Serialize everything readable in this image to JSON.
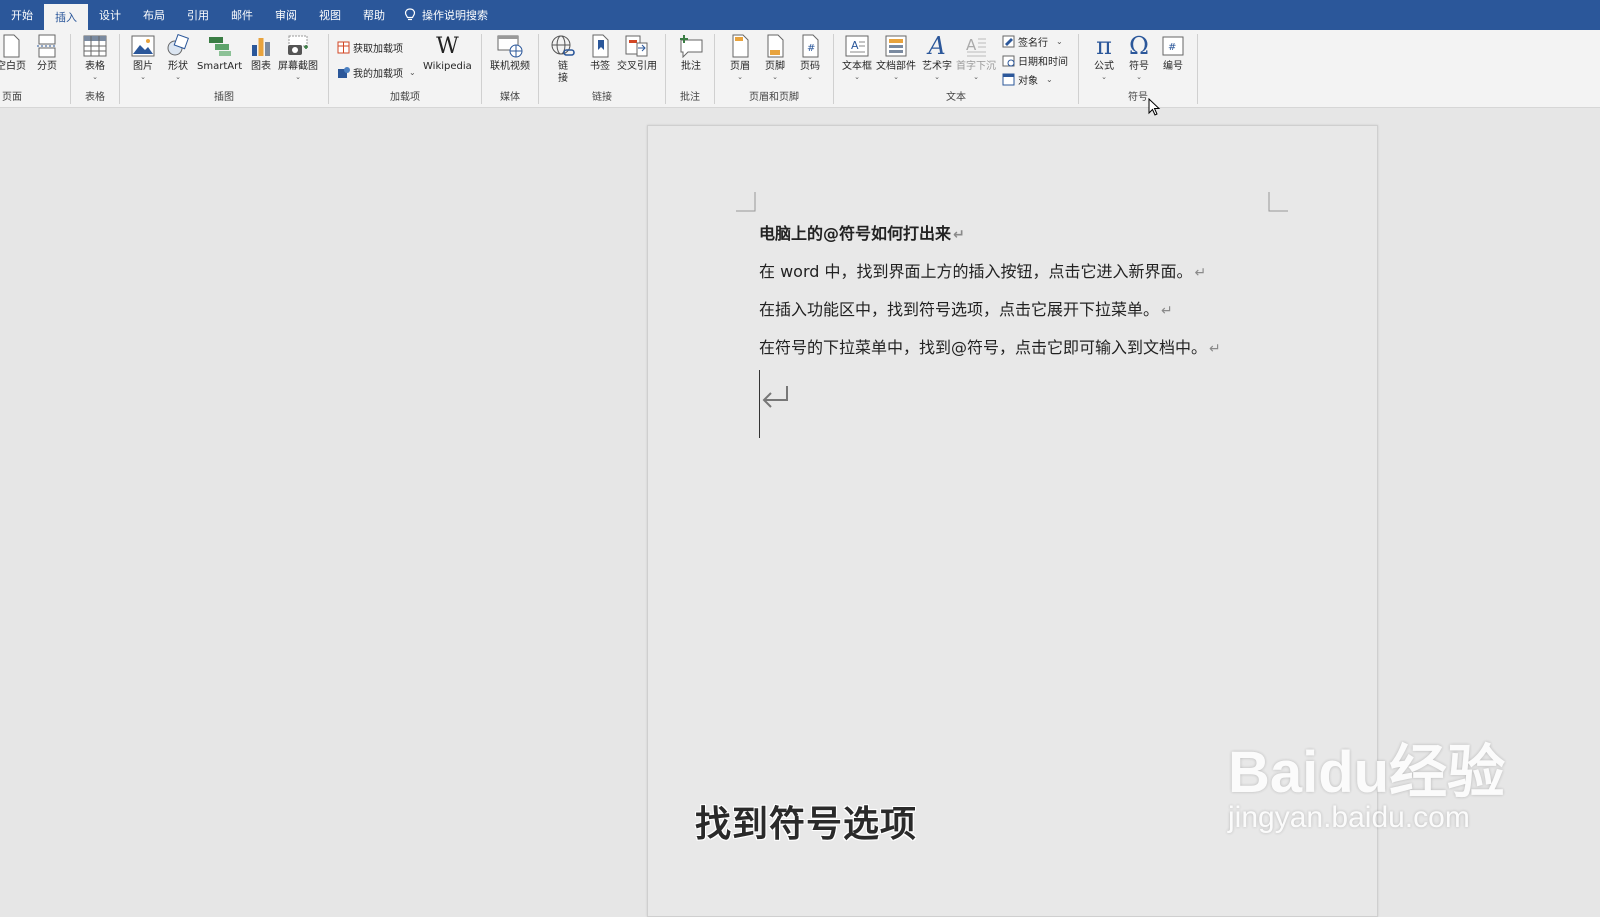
{
  "tabs": [
    {
      "label": "开始"
    },
    {
      "label": "插入",
      "active": true
    },
    {
      "label": "设计"
    },
    {
      "label": "布局"
    },
    {
      "label": "引用"
    },
    {
      "label": "邮件"
    },
    {
      "label": "审阅"
    },
    {
      "label": "视图"
    },
    {
      "label": "帮助"
    }
  ],
  "tellme": {
    "label": "操作说明搜索"
  },
  "ribbon": {
    "pages": {
      "label": "页面",
      "blank_page": "空白页",
      "page_break": "分页"
    },
    "tables": {
      "label": "表格",
      "table": "表格"
    },
    "illustrations": {
      "label": "插图",
      "picture": "图片",
      "shapes": "形状",
      "smartart": "SmartArt",
      "chart": "图表",
      "screenshot": "屏幕截图"
    },
    "addins": {
      "label": "加载项",
      "get_addins": "获取加载项",
      "my_addins": "我的加载项",
      "wikipedia": "Wikipedia"
    },
    "media": {
      "label": "媒体",
      "online_video": "联机视频"
    },
    "links": {
      "label": "链接",
      "link_line1": "链",
      "link_line2": "接",
      "bookmark": "书签",
      "cross_ref": "交叉引用"
    },
    "comments": {
      "label": "批注",
      "comment": "批注"
    },
    "header_footer": {
      "label": "页眉和页脚",
      "header": "页眉",
      "footer": "页脚",
      "page_number": "页码"
    },
    "text": {
      "label": "文本",
      "textbox": "文本框",
      "quick_parts": "文档部件",
      "wordart": "艺术字",
      "dropcap": "首字下沉",
      "signature": "签名行",
      "datetime": "日期和时间",
      "object": "对象"
    },
    "symbols": {
      "label": "符号",
      "equation": "公式",
      "symbol": "符号",
      "numbering": "编号"
    }
  },
  "document": {
    "title": "电脑上的@符号如何打出来",
    "lines": [
      "在 word 中，找到界面上方的插入按钮，点击它进入新界面。",
      "在插入功能区中，找到符号选项，点击它展开下拉菜单。",
      "在符号的下拉菜单中，找到@符号，点击它即可输入到文档中。"
    ],
    "paragraph_mark": "↵"
  },
  "overlay": {
    "subtitle": "找到符号选项",
    "watermark_brand": "Baidu经验",
    "watermark_url": "jingyan.baidu.com"
  },
  "colors": {
    "accent": "#2b579a",
    "ribbon_bg": "#f3f3f3",
    "canvas": "#e6e6e6"
  }
}
